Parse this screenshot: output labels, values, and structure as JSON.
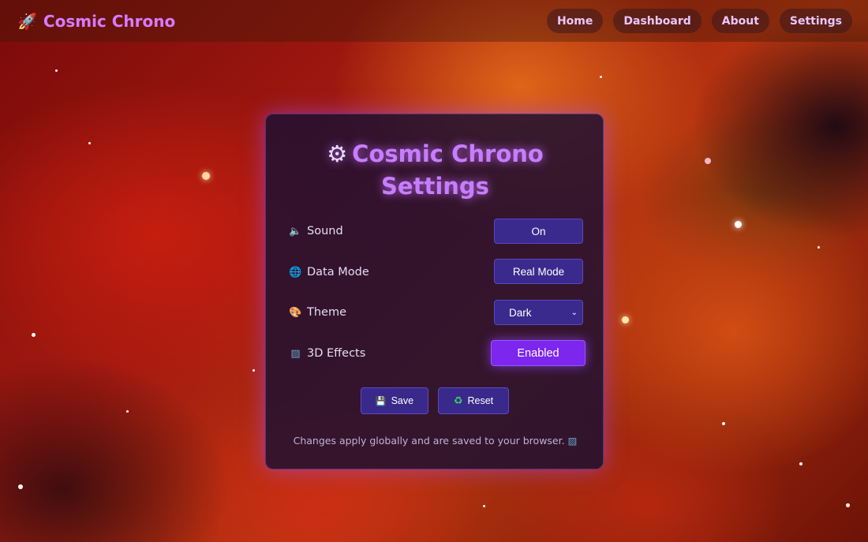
{
  "navbar": {
    "brand_icon": "rocket-icon",
    "brand_title": "Cosmic Chrono",
    "items": [
      {
        "label": "Home"
      },
      {
        "label": "Dashboard"
      },
      {
        "label": "About"
      },
      {
        "label": "Settings"
      }
    ]
  },
  "settings": {
    "title_line1": "Cosmic Chrono",
    "title_line2": "Settings",
    "title_icon": "gear-icon",
    "rows": [
      {
        "icon": "speaker-icon",
        "label": "Sound",
        "value": "On"
      },
      {
        "icon": "globe-icon",
        "label": "Data Mode",
        "value": "Real Mode"
      },
      {
        "icon": "palette-icon",
        "label": "Theme",
        "value": "Dark"
      },
      {
        "icon": "fabric-icon",
        "label": "3D Effects",
        "value": "Enabled"
      }
    ],
    "save_label": "Save",
    "reset_label": "Reset",
    "footnote": "Changes apply globally and are saved to your browser."
  },
  "colors": {
    "brand": "#d57bff",
    "title": "#c77dff",
    "button": "#3a2a8e",
    "accent_button": "#7c26ee",
    "panel": "#1c1032"
  }
}
